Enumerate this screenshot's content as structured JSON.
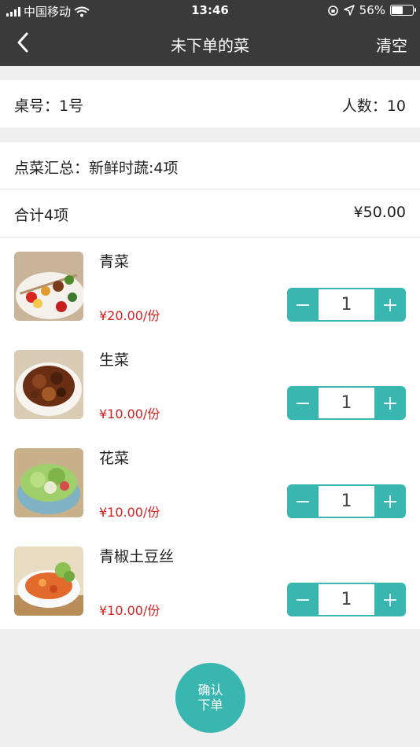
{
  "status": {
    "carrier": "中国移动",
    "time": "13:46",
    "battery": "56%",
    "battery_level": 0.56
  },
  "nav": {
    "title": "未下单的菜",
    "clear": "清空"
  },
  "table": {
    "label": "桌号：1号",
    "people": "人数：10"
  },
  "summary": {
    "detail": "点菜汇总：新鲜时蔬:4项",
    "total_label": "合计4项",
    "total_price": "¥50.00"
  },
  "dishes": [
    {
      "name": "青菜",
      "price": "¥20.00/份",
      "qty": "1"
    },
    {
      "name": "生菜",
      "price": "¥10.00/份",
      "qty": "1"
    },
    {
      "name": "花菜",
      "price": "¥10.00/份",
      "qty": "1"
    },
    {
      "name": "青椒土豆丝",
      "price": "¥10.00/份",
      "qty": "1"
    }
  ],
  "confirm": {
    "line1": "确认",
    "line2": "下单"
  },
  "colors": {
    "accent": "#39b6b0",
    "price": "#d62121",
    "header": "#3a3a3a"
  }
}
